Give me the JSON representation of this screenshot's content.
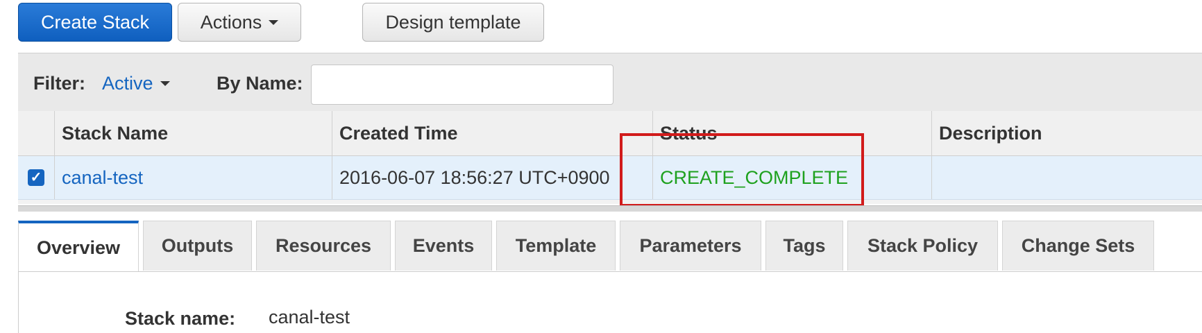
{
  "toolbar": {
    "create_stack": "Create Stack",
    "actions": "Actions",
    "design_template": "Design template"
  },
  "filter": {
    "filter_label": "Filter:",
    "filter_value": "Active",
    "by_name_label": "By Name:",
    "by_name_value": "",
    "by_name_placeholder": ""
  },
  "table": {
    "columns": [
      "Stack Name",
      "Created Time",
      "Status",
      "Description"
    ],
    "rows": [
      {
        "selected": true,
        "stack_name": "canal-test",
        "created_time": "2016-06-07 18:56:27 UTC+0900",
        "status": "CREATE_COMPLETE",
        "description": ""
      }
    ]
  },
  "tabs": [
    "Overview",
    "Outputs",
    "Resources",
    "Events",
    "Template",
    "Parameters",
    "Tags",
    "Stack Policy",
    "Change Sets"
  ],
  "active_tab": "Overview",
  "overview": {
    "stack_name_label": "Stack name:",
    "stack_name_value": "canal-test"
  },
  "icons": {
    "dropdown": "caret-down-icon",
    "checkbox": "checkbox-checked-icon"
  },
  "colors": {
    "primary": "#1565c0",
    "status_complete": "#1ea11e",
    "highlight": "#d11b1b"
  }
}
